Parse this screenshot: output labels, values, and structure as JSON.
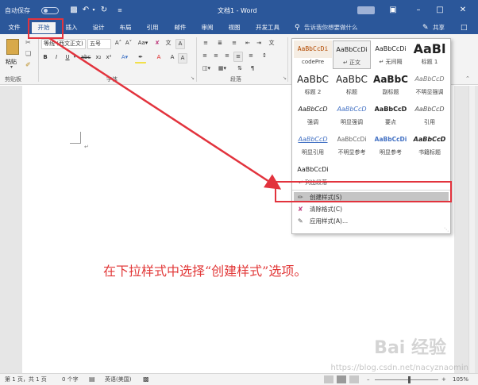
{
  "titlebar": {
    "autosave": "自动保存",
    "doc_title": "文档1  -  Word"
  },
  "menu": {
    "tabs": [
      "文件",
      "开始",
      "插入",
      "设计",
      "布局",
      "引用",
      "邮件",
      "审阅",
      "视图",
      "开发工具"
    ],
    "tell_me": "告诉我你想要做什么",
    "share": "共享"
  },
  "ribbon": {
    "paste": "粘贴",
    "font_name": "等线 (西文正文)",
    "font_size": "五号",
    "clipboard_label": "剪贴板",
    "font_label": "字体",
    "paragraph_label": "段落"
  },
  "styles_gallery": {
    "rows": [
      [
        {
          "preview": "AaBbCcDi",
          "name": "codePre"
        },
        {
          "preview": "AaBbCcDi",
          "name": "↵ 正文"
        },
        {
          "preview": "AaBbCcDi",
          "name": "↵ 无间隔"
        },
        {
          "preview": "AaBl",
          "name": "标题 1"
        }
      ],
      [
        {
          "preview": "AaBbC",
          "name": "标题 2"
        },
        {
          "preview": "AaBbC",
          "name": "标题"
        },
        {
          "preview": "AaBbC",
          "name": "副标题"
        },
        {
          "preview": "AaBbCcD",
          "name": "不明显强调"
        }
      ],
      [
        {
          "preview": "AaBbCcD",
          "name": "强调"
        },
        {
          "preview": "AaBbCcD",
          "name": "明显强调"
        },
        {
          "preview": "AaBbCcD",
          "name": "要点"
        },
        {
          "preview": "AaBbCcD",
          "name": "引用"
        }
      ],
      [
        {
          "preview": "AaBbCcD",
          "name": "明显引用"
        },
        {
          "preview": "AaBbCcDi",
          "name": "不明显参考"
        },
        {
          "preview": "AaBbCcDi",
          "name": "明显参考"
        },
        {
          "preview": "AaBbCcD",
          "name": "书籍标题"
        }
      ],
      [
        {
          "preview": "AaBbCcDi",
          "name": "↵ 列出段落"
        }
      ]
    ],
    "menu_items": [
      "创建样式(S)",
      "清除格式(C)",
      "应用样式(A)..."
    ]
  },
  "annotation": "在下拉样式中选择“创建样式”选项。",
  "status": {
    "page": "第 1 页，共 1 页",
    "words": "0 个字",
    "language": "英语(美国)",
    "zoom": "105%"
  },
  "watermark": {
    "logo": "Bai 经验",
    "url": "https://blog.csdn.net/nacyznaomin"
  }
}
